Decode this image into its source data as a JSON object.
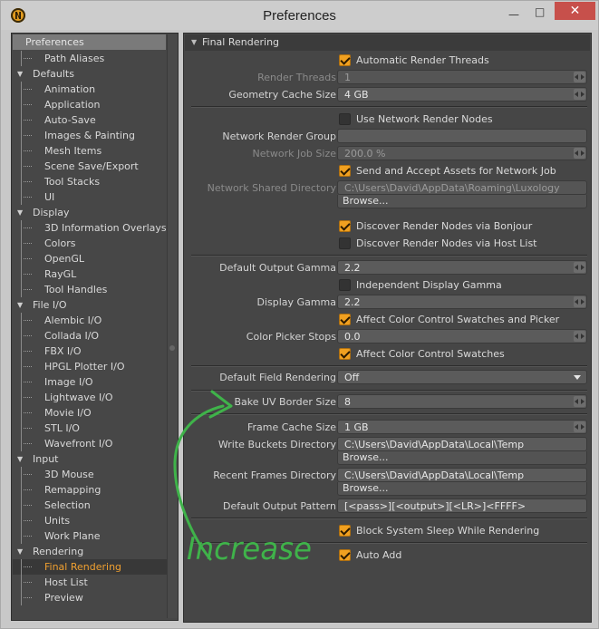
{
  "window": {
    "title": "Preferences",
    "minimize_icon": "minimize-icon",
    "maximize_icon": "maximize-icon",
    "close_icon": "close-icon"
  },
  "sidebar": {
    "header": "Preferences",
    "items": [
      {
        "label": "Path Aliases",
        "kind": "sub"
      },
      {
        "label": "Defaults",
        "kind": "cat"
      },
      {
        "label": "Animation",
        "kind": "sub"
      },
      {
        "label": "Application",
        "kind": "sub"
      },
      {
        "label": "Auto-Save",
        "kind": "sub"
      },
      {
        "label": "Images & Painting",
        "kind": "sub"
      },
      {
        "label": "Mesh Items",
        "kind": "sub"
      },
      {
        "label": "Scene Save/Export",
        "kind": "sub"
      },
      {
        "label": "Tool Stacks",
        "kind": "sub"
      },
      {
        "label": "UI",
        "kind": "sub"
      },
      {
        "label": "Display",
        "kind": "cat"
      },
      {
        "label": "3D Information Overlays",
        "kind": "sub"
      },
      {
        "label": "Colors",
        "kind": "sub"
      },
      {
        "label": "OpenGL",
        "kind": "sub"
      },
      {
        "label": "RayGL",
        "kind": "sub"
      },
      {
        "label": "Tool Handles",
        "kind": "sub"
      },
      {
        "label": "File I/O",
        "kind": "cat"
      },
      {
        "label": "Alembic I/O",
        "kind": "sub"
      },
      {
        "label": "Collada I/O",
        "kind": "sub"
      },
      {
        "label": "FBX I/O",
        "kind": "sub"
      },
      {
        "label": "HPGL Plotter I/O",
        "kind": "sub"
      },
      {
        "label": "Image I/O",
        "kind": "sub"
      },
      {
        "label": "Lightwave I/O",
        "kind": "sub"
      },
      {
        "label": "Movie I/O",
        "kind": "sub"
      },
      {
        "label": "STL I/O",
        "kind": "sub"
      },
      {
        "label": "Wavefront I/O",
        "kind": "sub"
      },
      {
        "label": "Input",
        "kind": "cat"
      },
      {
        "label": "3D Mouse",
        "kind": "sub"
      },
      {
        "label": "Remapping",
        "kind": "sub"
      },
      {
        "label": "Selection",
        "kind": "sub"
      },
      {
        "label": "Units",
        "kind": "sub"
      },
      {
        "label": "Work Plane",
        "kind": "sub"
      },
      {
        "label": "Rendering",
        "kind": "cat"
      },
      {
        "label": "Final Rendering",
        "kind": "sub",
        "selected": true
      },
      {
        "label": "Host List",
        "kind": "sub"
      },
      {
        "label": "Preview",
        "kind": "sub"
      }
    ]
  },
  "section": {
    "title": "Final Rendering"
  },
  "fields": {
    "auto_threads": {
      "label": "Automatic Render Threads",
      "checked": true
    },
    "render_threads": {
      "label": "Render Threads",
      "value": "1",
      "disabled": true
    },
    "geometry_cache": {
      "label": "Geometry Cache Size",
      "value": "4 GB"
    },
    "use_network": {
      "label": "Use Network Render Nodes",
      "checked": false
    },
    "network_group": {
      "label": "Network Render Group",
      "value": ""
    },
    "network_job_size": {
      "label": "Network Job Size",
      "value": "200.0 %",
      "disabled": true
    },
    "send_assets": {
      "label": "Send and Accept Assets for Network Job",
      "checked": true
    },
    "network_shared_dir": {
      "label": "Network Shared Directory",
      "value": "C:\\Users\\David\\AppData\\Roaming\\Luxology",
      "browse": "Browse...",
      "disabled": true
    },
    "bonjour": {
      "label": "Discover Render Nodes via Bonjour",
      "checked": true
    },
    "host_list": {
      "label": "Discover Render Nodes via Host List",
      "checked": false
    },
    "output_gamma": {
      "label": "Default Output Gamma",
      "value": "2.2"
    },
    "indep_gamma": {
      "label": "Independent Display Gamma",
      "checked": false
    },
    "display_gamma": {
      "label": "Display Gamma",
      "value": "2.2"
    },
    "affect_picker": {
      "label": "Affect Color Control Swatches and Picker",
      "checked": true
    },
    "picker_stops": {
      "label": "Color Picker Stops",
      "value": "0.0"
    },
    "affect_swatches": {
      "label": "Affect Color Control Swatches",
      "checked": true
    },
    "field_rendering": {
      "label": "Default Field Rendering",
      "value": "Off"
    },
    "bake_uv": {
      "label": "Bake UV Border Size",
      "value": "8"
    },
    "frame_cache": {
      "label": "Frame Cache Size",
      "value": "1 GB"
    },
    "write_buckets": {
      "label": "Write Buckets Directory",
      "value": "C:\\Users\\David\\AppData\\Local\\Temp",
      "browse": "Browse..."
    },
    "recent_frames": {
      "label": "Recent Frames Directory",
      "value": "C:\\Users\\David\\AppData\\Local\\Temp",
      "browse": "Browse..."
    },
    "output_pattern": {
      "label": "Default Output Pattern",
      "value": "[<pass>][<output>][<LR>]<FFFF>"
    },
    "block_sleep": {
      "label": "Block System Sleep While Rendering",
      "checked": true
    },
    "auto_add": {
      "label": "Auto Add",
      "checked": true
    }
  },
  "annotation": {
    "text": "Increase",
    "color": "#3fb34a"
  },
  "colors": {
    "accent": "#f0a020",
    "close": "#c7504b"
  }
}
